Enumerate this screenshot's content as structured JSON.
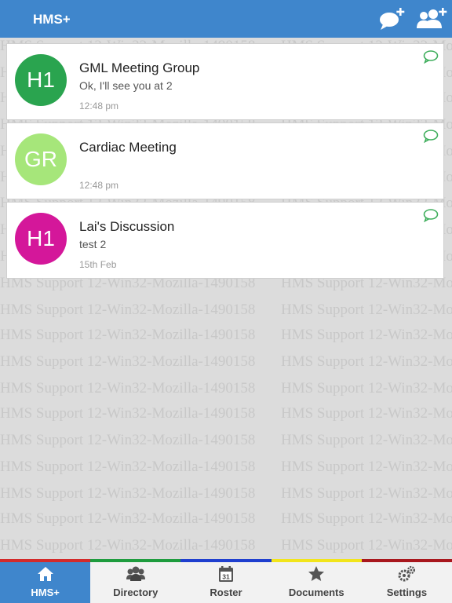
{
  "app": {
    "title": "HMS+"
  },
  "watermark": {
    "text": "HMS Support 12-Win32-Mozilla-1490158"
  },
  "conversations": [
    {
      "avatar": "H1",
      "avatar_color": "#2aa44f",
      "title": "GML Meeting Group",
      "message": "Ok, I'll see you at 2",
      "time": "12:48 pm"
    },
    {
      "avatar": "GR",
      "avatar_color": "#a6e67a",
      "title": "Cardiac Meeting",
      "message": "",
      "time": "12:48 pm"
    },
    {
      "avatar": "H1",
      "avatar_color": "#d4179a",
      "title": "Lai's Discussion",
      "message": "test 2",
      "time": "15th Feb"
    }
  ],
  "colors": {
    "accent": "#3f86cc",
    "chat_icon": "#3fae5c"
  },
  "colorbar": [
    "#d32b2b",
    "#1e9c3e",
    "#1f3fcf",
    "#f2e51b",
    "#a8171d"
  ],
  "tabs": [
    {
      "label": "HMS+",
      "icon": "home-icon"
    },
    {
      "label": "Directory",
      "icon": "people-icon"
    },
    {
      "label": "Roster",
      "icon": "calendar-icon",
      "calendar_day": "31"
    },
    {
      "label": "Documents",
      "icon": "star-icon"
    },
    {
      "label": "Settings",
      "icon": "gears-icon"
    }
  ]
}
